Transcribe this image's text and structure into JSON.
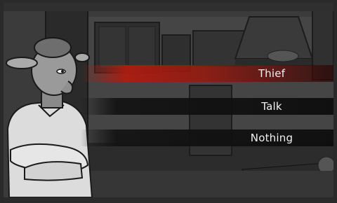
{
  "menu": {
    "choices": [
      {
        "label": "Thief",
        "selected": true
      },
      {
        "label": "Talk",
        "selected": false
      },
      {
        "label": "Nothing",
        "selected": false
      }
    ]
  },
  "colors": {
    "highlight": "#b01c10",
    "choice_bg": "#121212",
    "text": "#f0f0f0"
  }
}
